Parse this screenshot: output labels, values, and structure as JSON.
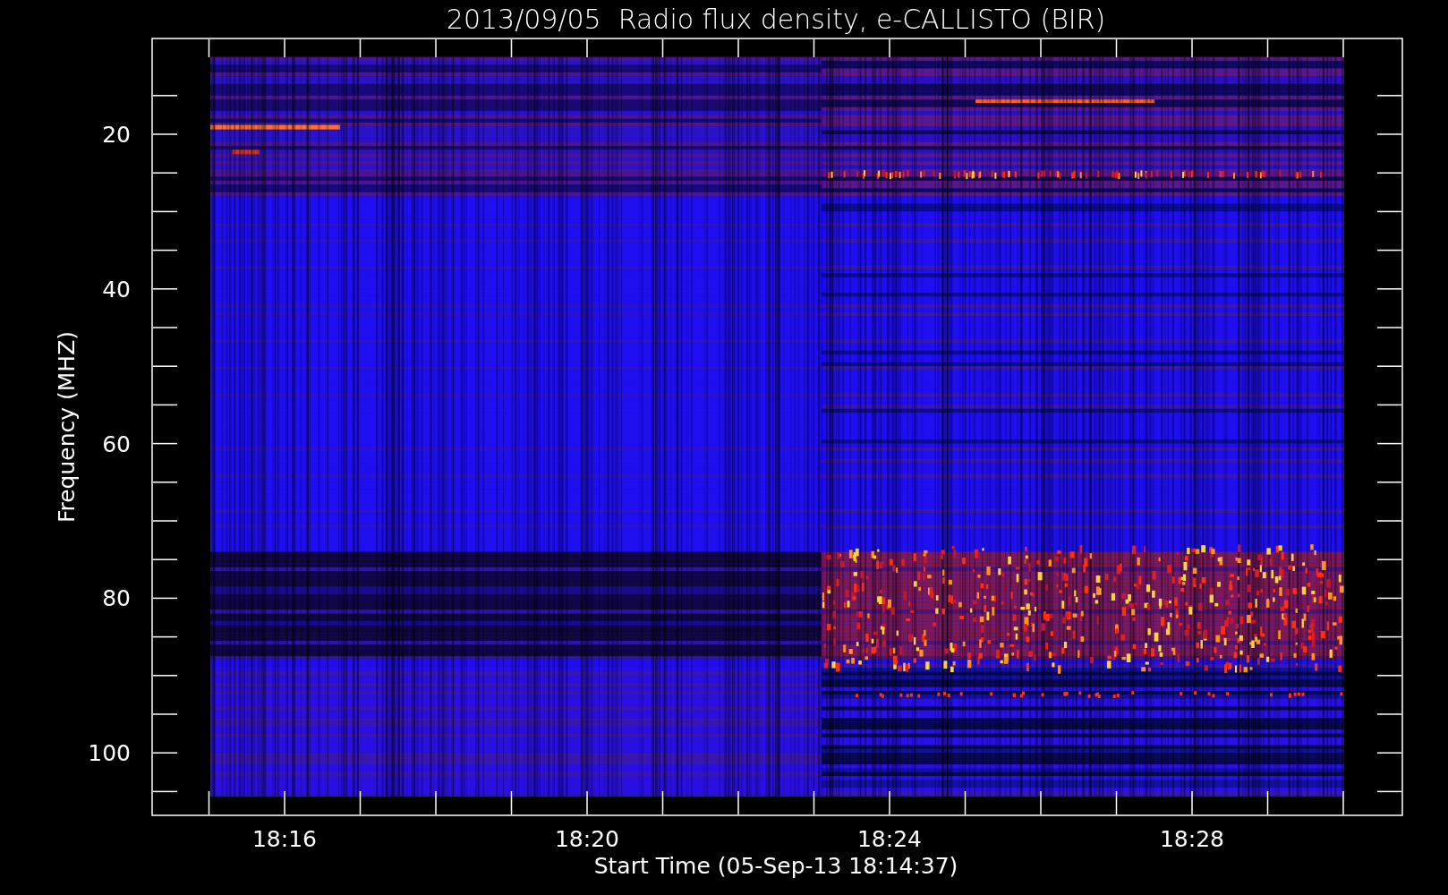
{
  "title": "2013/09/05  Radio flux density, e-CALLISTO (BIR)",
  "y_axis": {
    "label": "Frequency (MHZ)",
    "ticks": [
      "20",
      "40",
      "60",
      "80",
      "100"
    ]
  },
  "x_axis": {
    "label": "Start Time (05-Sep-13 18:14:37)",
    "ticks": [
      "18:16",
      "18:20",
      "18:24",
      "18:28"
    ]
  }
}
